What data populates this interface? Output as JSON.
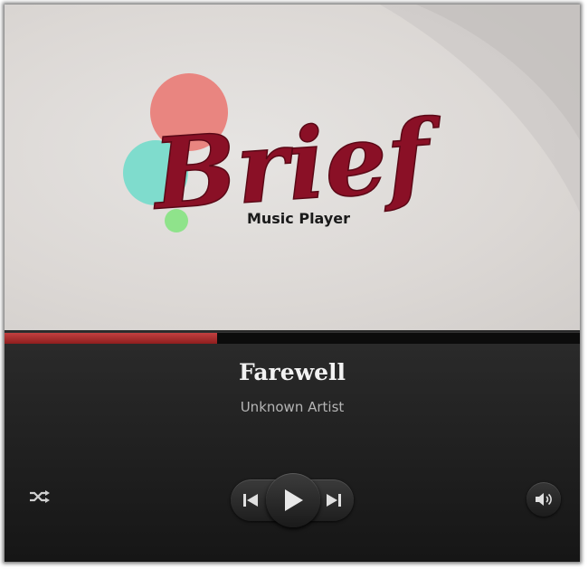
{
  "album_art": {
    "logo_text": "Brief",
    "logo_subtitle": "Music Player"
  },
  "track": {
    "title": "Farewell",
    "artist": "Unknown Artist",
    "progress_fraction": 0.37
  },
  "controls": {
    "shuffle_icon": "shuffle-icon",
    "previous_icon": "skip-previous-icon",
    "play_icon": "play-icon",
    "next_icon": "skip-next-icon",
    "volume_icon": "volume-icon"
  },
  "colors": {
    "accent": "#b53232",
    "logo_text": "#8a1026",
    "circle_red": "#e98580",
    "circle_teal": "#7fdccd",
    "circle_green": "#8fe38b"
  }
}
